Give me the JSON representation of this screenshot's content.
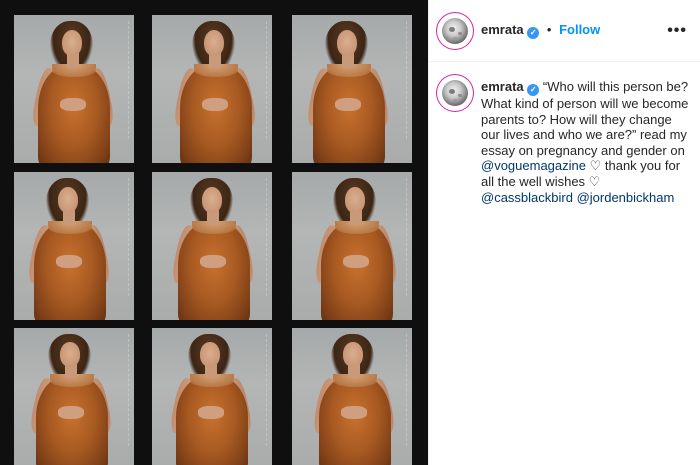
{
  "media": {
    "frames": [
      {
        "id": 1
      },
      {
        "id": 2
      },
      {
        "id": 3
      },
      {
        "id": 4
      },
      {
        "id": 5
      },
      {
        "id": 6
      },
      {
        "id": 7
      },
      {
        "id": 8
      },
      {
        "id": 9
      }
    ],
    "background_color": "#0f0f0f",
    "dress_color": "#a85a22"
  },
  "header": {
    "username": "emrata",
    "verified_icon": "verified-badge-icon",
    "dot": "•",
    "follow_label": "Follow",
    "more_icon": "•••"
  },
  "caption": {
    "username": "emrata",
    "text_1": "“Who will this person be? What kind of person will we become parents to? How will they change our lives and who we are?” read my essay on pregnancy and gender on ",
    "mention_1": "@voguemagazine",
    "heart_1": "♡",
    "text_2": " thank you for all the well wishes ",
    "heart_2": "♡",
    "mention_2": "@cassblackbird",
    "mention_3": "@jordenbickham"
  },
  "colors": {
    "link": "#0095f6",
    "mention": "#00376b",
    "verified": "#3897f0",
    "story_ring": "#d6249f"
  }
}
